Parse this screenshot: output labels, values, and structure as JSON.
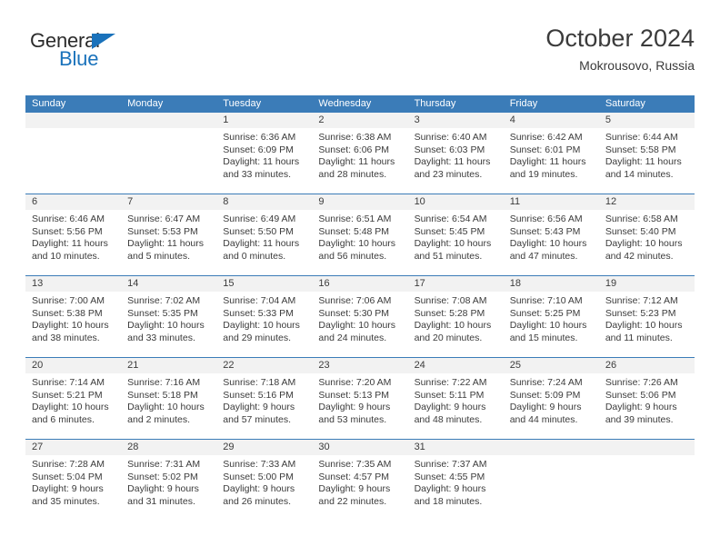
{
  "brand": {
    "name_top": "General",
    "name_bottom": "Blue",
    "triangle_icon": "blue-triangle-icon",
    "color_dark": "#2b2b2b",
    "color_blue": "#1a72bb"
  },
  "header": {
    "title": "October 2024",
    "subtitle": "Mokrousovo, Russia"
  },
  "theme": {
    "header_blue": "#3b7cb8",
    "daynum_band": "#f2f2f2",
    "text": "#3b3b3b"
  },
  "weekdays": [
    "Sunday",
    "Monday",
    "Tuesday",
    "Wednesday",
    "Thursday",
    "Friday",
    "Saturday"
  ],
  "weeks": [
    [
      {
        "day": "",
        "sunrise": "",
        "sunset": "",
        "daylight1": "",
        "daylight2": ""
      },
      {
        "day": "",
        "sunrise": "",
        "sunset": "",
        "daylight1": "",
        "daylight2": ""
      },
      {
        "day": "1",
        "sunrise": "Sunrise: 6:36 AM",
        "sunset": "Sunset: 6:09 PM",
        "daylight1": "Daylight: 11 hours",
        "daylight2": "and 33 minutes."
      },
      {
        "day": "2",
        "sunrise": "Sunrise: 6:38 AM",
        "sunset": "Sunset: 6:06 PM",
        "daylight1": "Daylight: 11 hours",
        "daylight2": "and 28 minutes."
      },
      {
        "day": "3",
        "sunrise": "Sunrise: 6:40 AM",
        "sunset": "Sunset: 6:03 PM",
        "daylight1": "Daylight: 11 hours",
        "daylight2": "and 23 minutes."
      },
      {
        "day": "4",
        "sunrise": "Sunrise: 6:42 AM",
        "sunset": "Sunset: 6:01 PM",
        "daylight1": "Daylight: 11 hours",
        "daylight2": "and 19 minutes."
      },
      {
        "day": "5",
        "sunrise": "Sunrise: 6:44 AM",
        "sunset": "Sunset: 5:58 PM",
        "daylight1": "Daylight: 11 hours",
        "daylight2": "and 14 minutes."
      }
    ],
    [
      {
        "day": "6",
        "sunrise": "Sunrise: 6:46 AM",
        "sunset": "Sunset: 5:56 PM",
        "daylight1": "Daylight: 11 hours",
        "daylight2": "and 10 minutes."
      },
      {
        "day": "7",
        "sunrise": "Sunrise: 6:47 AM",
        "sunset": "Sunset: 5:53 PM",
        "daylight1": "Daylight: 11 hours",
        "daylight2": "and 5 minutes."
      },
      {
        "day": "8",
        "sunrise": "Sunrise: 6:49 AM",
        "sunset": "Sunset: 5:50 PM",
        "daylight1": "Daylight: 11 hours",
        "daylight2": "and 0 minutes."
      },
      {
        "day": "9",
        "sunrise": "Sunrise: 6:51 AM",
        "sunset": "Sunset: 5:48 PM",
        "daylight1": "Daylight: 10 hours",
        "daylight2": "and 56 minutes."
      },
      {
        "day": "10",
        "sunrise": "Sunrise: 6:54 AM",
        "sunset": "Sunset: 5:45 PM",
        "daylight1": "Daylight: 10 hours",
        "daylight2": "and 51 minutes."
      },
      {
        "day": "11",
        "sunrise": "Sunrise: 6:56 AM",
        "sunset": "Sunset: 5:43 PM",
        "daylight1": "Daylight: 10 hours",
        "daylight2": "and 47 minutes."
      },
      {
        "day": "12",
        "sunrise": "Sunrise: 6:58 AM",
        "sunset": "Sunset: 5:40 PM",
        "daylight1": "Daylight: 10 hours",
        "daylight2": "and 42 minutes."
      }
    ],
    [
      {
        "day": "13",
        "sunrise": "Sunrise: 7:00 AM",
        "sunset": "Sunset: 5:38 PM",
        "daylight1": "Daylight: 10 hours",
        "daylight2": "and 38 minutes."
      },
      {
        "day": "14",
        "sunrise": "Sunrise: 7:02 AM",
        "sunset": "Sunset: 5:35 PM",
        "daylight1": "Daylight: 10 hours",
        "daylight2": "and 33 minutes."
      },
      {
        "day": "15",
        "sunrise": "Sunrise: 7:04 AM",
        "sunset": "Sunset: 5:33 PM",
        "daylight1": "Daylight: 10 hours",
        "daylight2": "and 29 minutes."
      },
      {
        "day": "16",
        "sunrise": "Sunrise: 7:06 AM",
        "sunset": "Sunset: 5:30 PM",
        "daylight1": "Daylight: 10 hours",
        "daylight2": "and 24 minutes."
      },
      {
        "day": "17",
        "sunrise": "Sunrise: 7:08 AM",
        "sunset": "Sunset: 5:28 PM",
        "daylight1": "Daylight: 10 hours",
        "daylight2": "and 20 minutes."
      },
      {
        "day": "18",
        "sunrise": "Sunrise: 7:10 AM",
        "sunset": "Sunset: 5:25 PM",
        "daylight1": "Daylight: 10 hours",
        "daylight2": "and 15 minutes."
      },
      {
        "day": "19",
        "sunrise": "Sunrise: 7:12 AM",
        "sunset": "Sunset: 5:23 PM",
        "daylight1": "Daylight: 10 hours",
        "daylight2": "and 11 minutes."
      }
    ],
    [
      {
        "day": "20",
        "sunrise": "Sunrise: 7:14 AM",
        "sunset": "Sunset: 5:21 PM",
        "daylight1": "Daylight: 10 hours",
        "daylight2": "and 6 minutes."
      },
      {
        "day": "21",
        "sunrise": "Sunrise: 7:16 AM",
        "sunset": "Sunset: 5:18 PM",
        "daylight1": "Daylight: 10 hours",
        "daylight2": "and 2 minutes."
      },
      {
        "day": "22",
        "sunrise": "Sunrise: 7:18 AM",
        "sunset": "Sunset: 5:16 PM",
        "daylight1": "Daylight: 9 hours",
        "daylight2": "and 57 minutes."
      },
      {
        "day": "23",
        "sunrise": "Sunrise: 7:20 AM",
        "sunset": "Sunset: 5:13 PM",
        "daylight1": "Daylight: 9 hours",
        "daylight2": "and 53 minutes."
      },
      {
        "day": "24",
        "sunrise": "Sunrise: 7:22 AM",
        "sunset": "Sunset: 5:11 PM",
        "daylight1": "Daylight: 9 hours",
        "daylight2": "and 48 minutes."
      },
      {
        "day": "25",
        "sunrise": "Sunrise: 7:24 AM",
        "sunset": "Sunset: 5:09 PM",
        "daylight1": "Daylight: 9 hours",
        "daylight2": "and 44 minutes."
      },
      {
        "day": "26",
        "sunrise": "Sunrise: 7:26 AM",
        "sunset": "Sunset: 5:06 PM",
        "daylight1": "Daylight: 9 hours",
        "daylight2": "and 39 minutes."
      }
    ],
    [
      {
        "day": "27",
        "sunrise": "Sunrise: 7:28 AM",
        "sunset": "Sunset: 5:04 PM",
        "daylight1": "Daylight: 9 hours",
        "daylight2": "and 35 minutes."
      },
      {
        "day": "28",
        "sunrise": "Sunrise: 7:31 AM",
        "sunset": "Sunset: 5:02 PM",
        "daylight1": "Daylight: 9 hours",
        "daylight2": "and 31 minutes."
      },
      {
        "day": "29",
        "sunrise": "Sunrise: 7:33 AM",
        "sunset": "Sunset: 5:00 PM",
        "daylight1": "Daylight: 9 hours",
        "daylight2": "and 26 minutes."
      },
      {
        "day": "30",
        "sunrise": "Sunrise: 7:35 AM",
        "sunset": "Sunset: 4:57 PM",
        "daylight1": "Daylight: 9 hours",
        "daylight2": "and 22 minutes."
      },
      {
        "day": "31",
        "sunrise": "Sunrise: 7:37 AM",
        "sunset": "Sunset: 4:55 PM",
        "daylight1": "Daylight: 9 hours",
        "daylight2": "and 18 minutes."
      },
      {
        "day": "",
        "sunrise": "",
        "sunset": "",
        "daylight1": "",
        "daylight2": ""
      },
      {
        "day": "",
        "sunrise": "",
        "sunset": "",
        "daylight1": "",
        "daylight2": ""
      }
    ]
  ]
}
